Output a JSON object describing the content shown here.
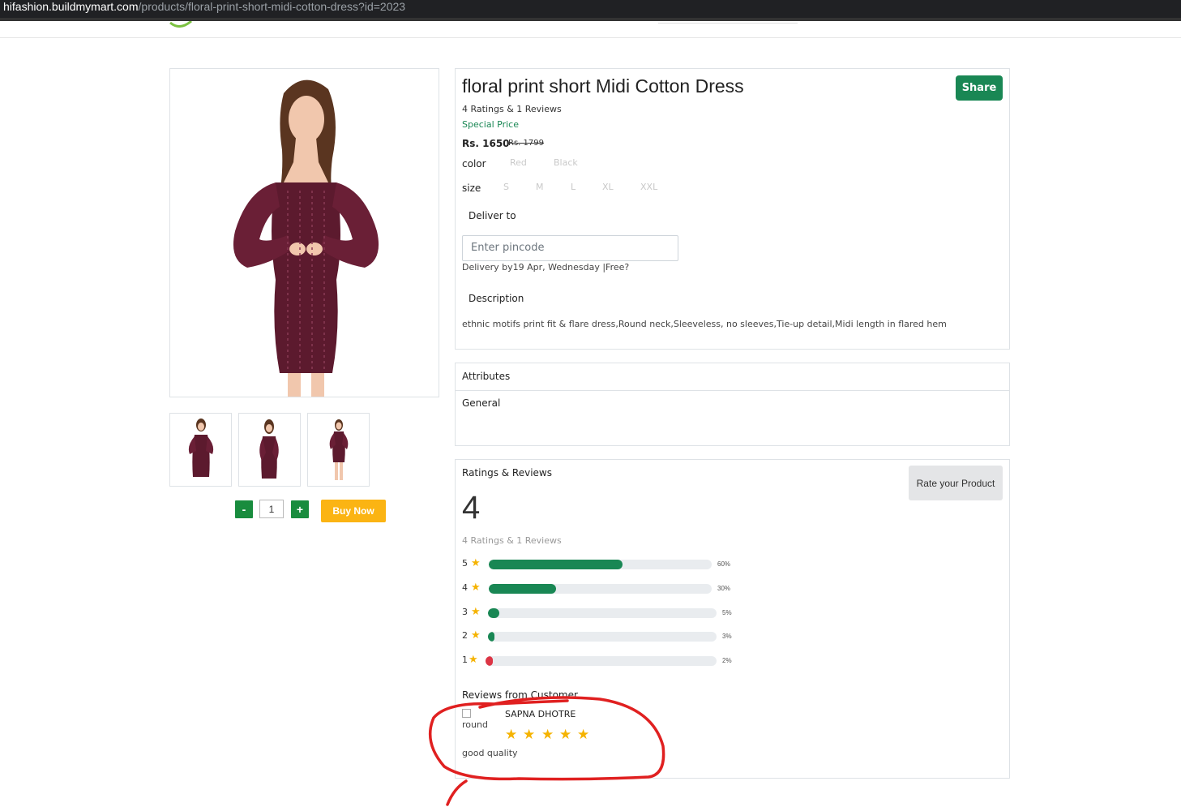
{
  "browser": {
    "url_domain": "hifashion.buildmymart.com",
    "url_path": "/products/floral-print-short-midi-cotton-dress?id=2023"
  },
  "product": {
    "title": "floral print short Midi Cotton Dress",
    "share_label": "Share",
    "ratings_summary": "4 Ratings & 1 Reviews",
    "special_price_label": "Special Price",
    "price": "Rs. 1650",
    "original_price": "Rs. 1799",
    "color_label": "color",
    "colors": [
      "Red",
      "Black"
    ],
    "size_label": "size",
    "sizes": [
      "S",
      "M",
      "L",
      "XL",
      "XXL"
    ],
    "deliver_to_label": "Deliver to",
    "pincode_placeholder": "Enter pincode",
    "delivery_text": "Delivery by19 Apr, Wednesday |Free?",
    "description_label": "Description",
    "description": "ethnic motifs print fit & flare dress,Round neck,Sleeveless, no sleeves,Tie-up detail,Midi length in flared hem",
    "dress_color": "#5c1a2e"
  },
  "purchase": {
    "minus": "-",
    "quantity": "1",
    "plus": "+",
    "buy_now": "Buy Now"
  },
  "attributes": {
    "heading": "Attributes",
    "group": "General"
  },
  "ratings": {
    "heading": "Ratings & Reviews",
    "rate_button": "Rate your Product",
    "average": "4",
    "summary": "4 Ratings & 1 Reviews",
    "rows": [
      {
        "stars": "5",
        "percent_label": "60%",
        "percent": 60,
        "color": "#198754"
      },
      {
        "stars": "4",
        "percent_label": "30%",
        "percent": 30,
        "color": "#198754"
      },
      {
        "stars": "3",
        "percent_label": "5%",
        "percent": 5,
        "color": "#198754"
      },
      {
        "stars": "2",
        "percent_label": "3%",
        "percent": 3,
        "color": "#198754"
      },
      {
        "stars": "1",
        "percent_label": "2%",
        "percent": 2,
        "color": "#dc3545"
      }
    ],
    "reviews_heading": "Reviews from Customer",
    "review": {
      "avatar_alt": "round",
      "name": "SAPNA DHOTRE",
      "stars": 5,
      "text": "good quality"
    }
  },
  "colors": {
    "accent_green": "#198754",
    "buy_yellow": "#fbb413",
    "star_yellow": "#f5b301",
    "annotation_red": "#e02020"
  }
}
